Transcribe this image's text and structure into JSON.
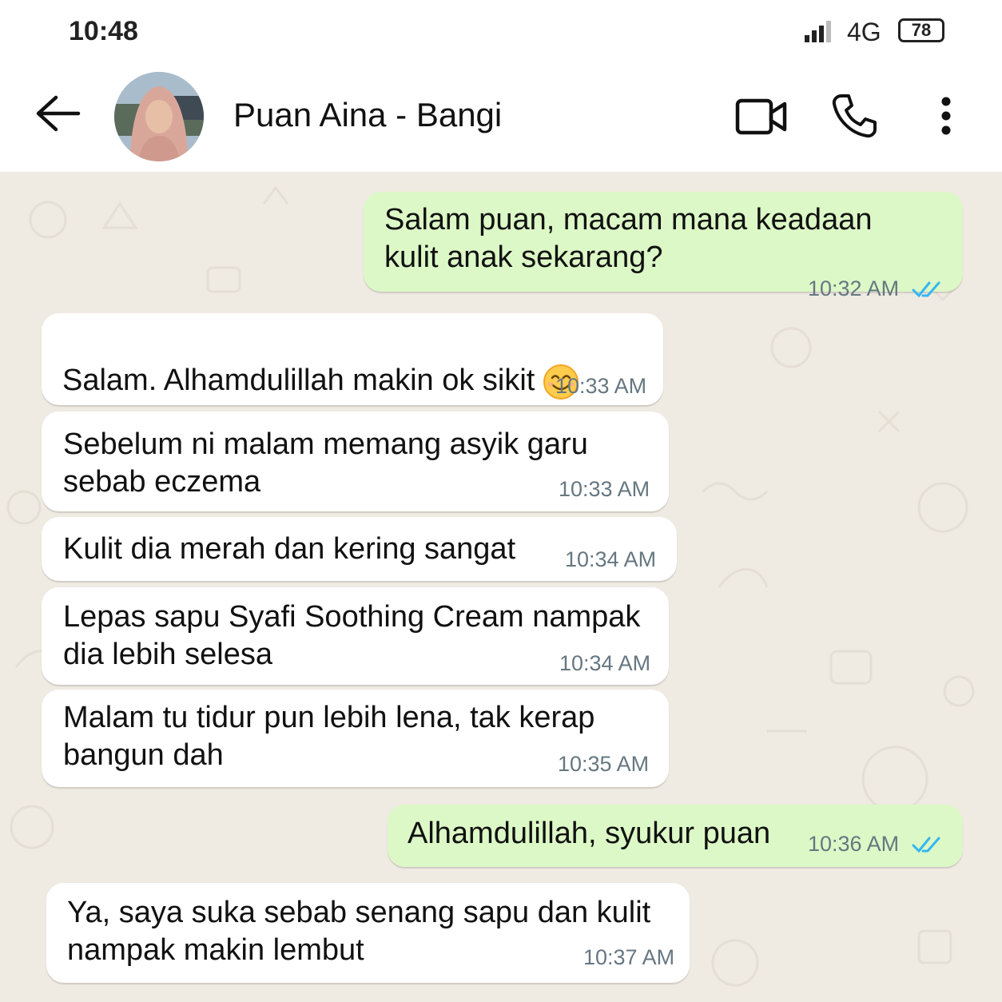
{
  "status_bar": {
    "time": "10:48",
    "network": "4G",
    "battery": "78"
  },
  "header": {
    "contact_name": "Puan Aina - Bangi",
    "icons": [
      "back-arrow-icon",
      "video-call-icon",
      "phone-icon",
      "more-vert-icon"
    ]
  },
  "colors": {
    "chat_background": "#efeae2",
    "outgoing_bubble": "#dcf8c6",
    "incoming_bubble": "#ffffff",
    "read_ticks": "#34b7f1"
  },
  "messages": [
    {
      "direction": "out",
      "text": "Salam puan, macam mana keadaan\nkulit anak sekarang?",
      "time": "10:32 AM",
      "status": "read"
    },
    {
      "direction": "in",
      "text": "Salam. Alhamdulillah makin ok sikit",
      "emoji": "smiling-face-icon",
      "time": "10:33 AM"
    },
    {
      "direction": "in",
      "text": "Sebelum ni malam memang asyik garu\nsebab eczema",
      "time": "10:33 AM"
    },
    {
      "direction": "in",
      "text": "Kulit dia merah dan kering sangat",
      "time": "10:34 AM"
    },
    {
      "direction": "in",
      "text": "Lepas sapu Syafi Soothing Cream nampak\ndia lebih selesa",
      "time": "10:34 AM"
    },
    {
      "direction": "in",
      "text": "Malam tu tidur pun lebih lena, tak kerap\nbangun dah",
      "time": "10:35 AM"
    },
    {
      "direction": "out",
      "text": "Alhamdulillah, syukur puan",
      "time": "10:36 AM",
      "status": "read"
    },
    {
      "direction": "in",
      "text": "Ya, saya suka sebab senang sapu dan kulit\nnampak makin lembut",
      "time": "10:37 AM"
    }
  ]
}
